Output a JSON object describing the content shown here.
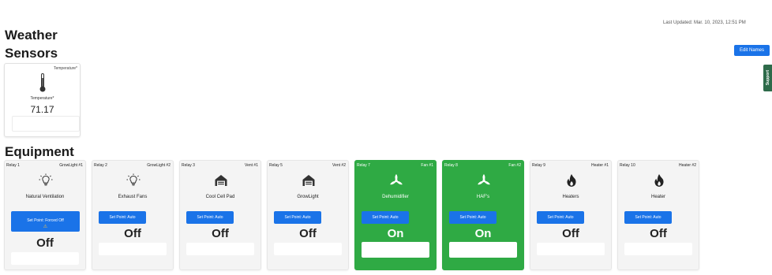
{
  "header": {
    "last_updated": "Last Updated: Mar. 10, 2023, 12:51 PM",
    "title_line1": "Weather",
    "title_line2": "Sensors",
    "edit_names_label": "Edit Names",
    "support_label": "Support"
  },
  "sensors": [
    {
      "header": "Temperature*",
      "label": "Temperature*",
      "value": "71.17",
      "icon": "thermometer-icon"
    }
  ],
  "equipment_title": "Equipment",
  "equipment": [
    {
      "relay": "Relay 1",
      "name": "GrowLight #1",
      "description": "Natural Ventilation",
      "setpoint": "Set Point: Forced Off",
      "warning": "⚠",
      "state": "Off",
      "on": false,
      "icon": "lightbulb-icon"
    },
    {
      "relay": "Relay 2",
      "name": "GrowLight #2",
      "description": "Exhaust Fans",
      "setpoint": "Set Point: Auto",
      "state": "Off",
      "on": false,
      "icon": "lightbulb-icon"
    },
    {
      "relay": "Relay 3",
      "name": "Vent #1",
      "description": "Cool Cell Pad",
      "setpoint": "Set Point: Auto",
      "state": "Off",
      "on": false,
      "icon": "vent-icon"
    },
    {
      "relay": "Relay 5",
      "name": "Vent #2",
      "description": "GrowLight",
      "setpoint": "Set Point: Auto",
      "state": "Off",
      "on": false,
      "icon": "vent-icon"
    },
    {
      "relay": "Relay 7",
      "name": "Fan #1",
      "description": "Dehumidifier",
      "setpoint": "Set Point: Auto",
      "state": "On",
      "on": true,
      "icon": "fan-icon"
    },
    {
      "relay": "Relay 8",
      "name": "Fan #2",
      "description": "HAF's",
      "setpoint": "Set Point: Auto",
      "state": "On",
      "on": true,
      "icon": "fan-icon"
    },
    {
      "relay": "Relay 9",
      "name": "Heater #1",
      "description": "Heaters",
      "setpoint": "Set Point: Auto",
      "state": "Off",
      "on": false,
      "icon": "flame-icon"
    },
    {
      "relay": "Relay 10",
      "name": "Heater #2",
      "description": "Heater",
      "setpoint": "Set Point: Auto",
      "state": "Off",
      "on": false,
      "icon": "flame-icon"
    }
  ],
  "colors": {
    "primary_button": "#1a73e8",
    "on_card": "#2faa44",
    "off_card": "#f4f4f4",
    "support_tab": "#2e6b4a"
  }
}
